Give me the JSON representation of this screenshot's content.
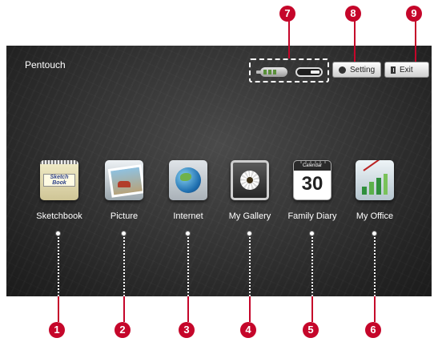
{
  "app": {
    "title": "Pentouch"
  },
  "toolbar": {
    "setting_label": "Setting",
    "exit_label": "Exit"
  },
  "status": {
    "pen_battery_icon": "battery-icon",
    "receiver_icon": "dongle-icon"
  },
  "apps": [
    {
      "label": "Sketchbook",
      "tile_text": "Sketch Book",
      "icon": "sketchbook-icon"
    },
    {
      "label": "Picture",
      "icon": "picture-icon"
    },
    {
      "label": "Internet",
      "icon": "globe-icon"
    },
    {
      "label": "My Gallery",
      "icon": "flower-photo-icon"
    },
    {
      "label": "Family Diary",
      "tile_header": "Calendar",
      "tile_number": "30",
      "icon": "calendar-icon"
    },
    {
      "label": "My Office",
      "icon": "chart-icon"
    }
  ],
  "callouts": [
    "1",
    "2",
    "3",
    "4",
    "5",
    "6",
    "7",
    "8",
    "9"
  ],
  "colors": {
    "callout": "#c5062a",
    "screen_background": "#2e2e2e"
  }
}
